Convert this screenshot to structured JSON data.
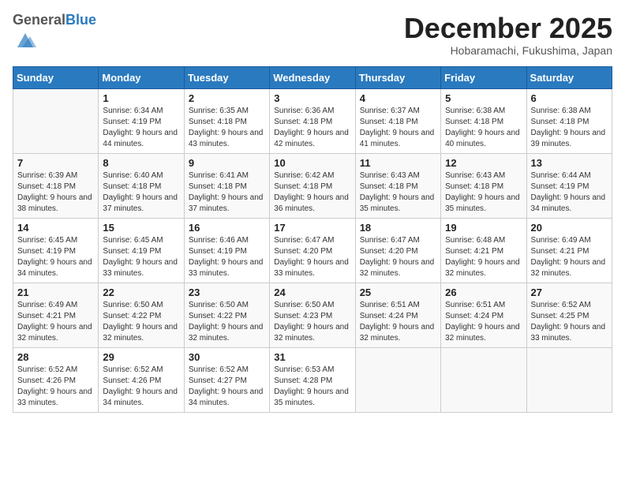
{
  "logo": {
    "general": "General",
    "blue": "Blue"
  },
  "header": {
    "month": "December 2025",
    "location": "Hobaramachi, Fukushima, Japan"
  },
  "weekdays": [
    "Sunday",
    "Monday",
    "Tuesday",
    "Wednesday",
    "Thursday",
    "Friday",
    "Saturday"
  ],
  "weeks": [
    [
      {
        "num": "",
        "empty": true
      },
      {
        "num": "1",
        "sunrise": "Sunrise: 6:34 AM",
        "sunset": "Sunset: 4:19 PM",
        "daylight": "Daylight: 9 hours and 44 minutes."
      },
      {
        "num": "2",
        "sunrise": "Sunrise: 6:35 AM",
        "sunset": "Sunset: 4:18 PM",
        "daylight": "Daylight: 9 hours and 43 minutes."
      },
      {
        "num": "3",
        "sunrise": "Sunrise: 6:36 AM",
        "sunset": "Sunset: 4:18 PM",
        "daylight": "Daylight: 9 hours and 42 minutes."
      },
      {
        "num": "4",
        "sunrise": "Sunrise: 6:37 AM",
        "sunset": "Sunset: 4:18 PM",
        "daylight": "Daylight: 9 hours and 41 minutes."
      },
      {
        "num": "5",
        "sunrise": "Sunrise: 6:38 AM",
        "sunset": "Sunset: 4:18 PM",
        "daylight": "Daylight: 9 hours and 40 minutes."
      },
      {
        "num": "6",
        "sunrise": "Sunrise: 6:38 AM",
        "sunset": "Sunset: 4:18 PM",
        "daylight": "Daylight: 9 hours and 39 minutes."
      }
    ],
    [
      {
        "num": "7",
        "sunrise": "Sunrise: 6:39 AM",
        "sunset": "Sunset: 4:18 PM",
        "daylight": "Daylight: 9 hours and 38 minutes."
      },
      {
        "num": "8",
        "sunrise": "Sunrise: 6:40 AM",
        "sunset": "Sunset: 4:18 PM",
        "daylight": "Daylight: 9 hours and 37 minutes."
      },
      {
        "num": "9",
        "sunrise": "Sunrise: 6:41 AM",
        "sunset": "Sunset: 4:18 PM",
        "daylight": "Daylight: 9 hours and 37 minutes."
      },
      {
        "num": "10",
        "sunrise": "Sunrise: 6:42 AM",
        "sunset": "Sunset: 4:18 PM",
        "daylight": "Daylight: 9 hours and 36 minutes."
      },
      {
        "num": "11",
        "sunrise": "Sunrise: 6:43 AM",
        "sunset": "Sunset: 4:18 PM",
        "daylight": "Daylight: 9 hours and 35 minutes."
      },
      {
        "num": "12",
        "sunrise": "Sunrise: 6:43 AM",
        "sunset": "Sunset: 4:18 PM",
        "daylight": "Daylight: 9 hours and 35 minutes."
      },
      {
        "num": "13",
        "sunrise": "Sunrise: 6:44 AM",
        "sunset": "Sunset: 4:19 PM",
        "daylight": "Daylight: 9 hours and 34 minutes."
      }
    ],
    [
      {
        "num": "14",
        "sunrise": "Sunrise: 6:45 AM",
        "sunset": "Sunset: 4:19 PM",
        "daylight": "Daylight: 9 hours and 34 minutes."
      },
      {
        "num": "15",
        "sunrise": "Sunrise: 6:45 AM",
        "sunset": "Sunset: 4:19 PM",
        "daylight": "Daylight: 9 hours and 33 minutes."
      },
      {
        "num": "16",
        "sunrise": "Sunrise: 6:46 AM",
        "sunset": "Sunset: 4:19 PM",
        "daylight": "Daylight: 9 hours and 33 minutes."
      },
      {
        "num": "17",
        "sunrise": "Sunrise: 6:47 AM",
        "sunset": "Sunset: 4:20 PM",
        "daylight": "Daylight: 9 hours and 33 minutes."
      },
      {
        "num": "18",
        "sunrise": "Sunrise: 6:47 AM",
        "sunset": "Sunset: 4:20 PM",
        "daylight": "Daylight: 9 hours and 32 minutes."
      },
      {
        "num": "19",
        "sunrise": "Sunrise: 6:48 AM",
        "sunset": "Sunset: 4:21 PM",
        "daylight": "Daylight: 9 hours and 32 minutes."
      },
      {
        "num": "20",
        "sunrise": "Sunrise: 6:49 AM",
        "sunset": "Sunset: 4:21 PM",
        "daylight": "Daylight: 9 hours and 32 minutes."
      }
    ],
    [
      {
        "num": "21",
        "sunrise": "Sunrise: 6:49 AM",
        "sunset": "Sunset: 4:21 PM",
        "daylight": "Daylight: 9 hours and 32 minutes."
      },
      {
        "num": "22",
        "sunrise": "Sunrise: 6:50 AM",
        "sunset": "Sunset: 4:22 PM",
        "daylight": "Daylight: 9 hours and 32 minutes."
      },
      {
        "num": "23",
        "sunrise": "Sunrise: 6:50 AM",
        "sunset": "Sunset: 4:22 PM",
        "daylight": "Daylight: 9 hours and 32 minutes."
      },
      {
        "num": "24",
        "sunrise": "Sunrise: 6:50 AM",
        "sunset": "Sunset: 4:23 PM",
        "daylight": "Daylight: 9 hours and 32 minutes."
      },
      {
        "num": "25",
        "sunrise": "Sunrise: 6:51 AM",
        "sunset": "Sunset: 4:24 PM",
        "daylight": "Daylight: 9 hours and 32 minutes."
      },
      {
        "num": "26",
        "sunrise": "Sunrise: 6:51 AM",
        "sunset": "Sunset: 4:24 PM",
        "daylight": "Daylight: 9 hours and 32 minutes."
      },
      {
        "num": "27",
        "sunrise": "Sunrise: 6:52 AM",
        "sunset": "Sunset: 4:25 PM",
        "daylight": "Daylight: 9 hours and 33 minutes."
      }
    ],
    [
      {
        "num": "28",
        "sunrise": "Sunrise: 6:52 AM",
        "sunset": "Sunset: 4:26 PM",
        "daylight": "Daylight: 9 hours and 33 minutes."
      },
      {
        "num": "29",
        "sunrise": "Sunrise: 6:52 AM",
        "sunset": "Sunset: 4:26 PM",
        "daylight": "Daylight: 9 hours and 34 minutes."
      },
      {
        "num": "30",
        "sunrise": "Sunrise: 6:52 AM",
        "sunset": "Sunset: 4:27 PM",
        "daylight": "Daylight: 9 hours and 34 minutes."
      },
      {
        "num": "31",
        "sunrise": "Sunrise: 6:53 AM",
        "sunset": "Sunset: 4:28 PM",
        "daylight": "Daylight: 9 hours and 35 minutes."
      },
      {
        "num": "",
        "empty": true
      },
      {
        "num": "",
        "empty": true
      },
      {
        "num": "",
        "empty": true
      }
    ]
  ]
}
